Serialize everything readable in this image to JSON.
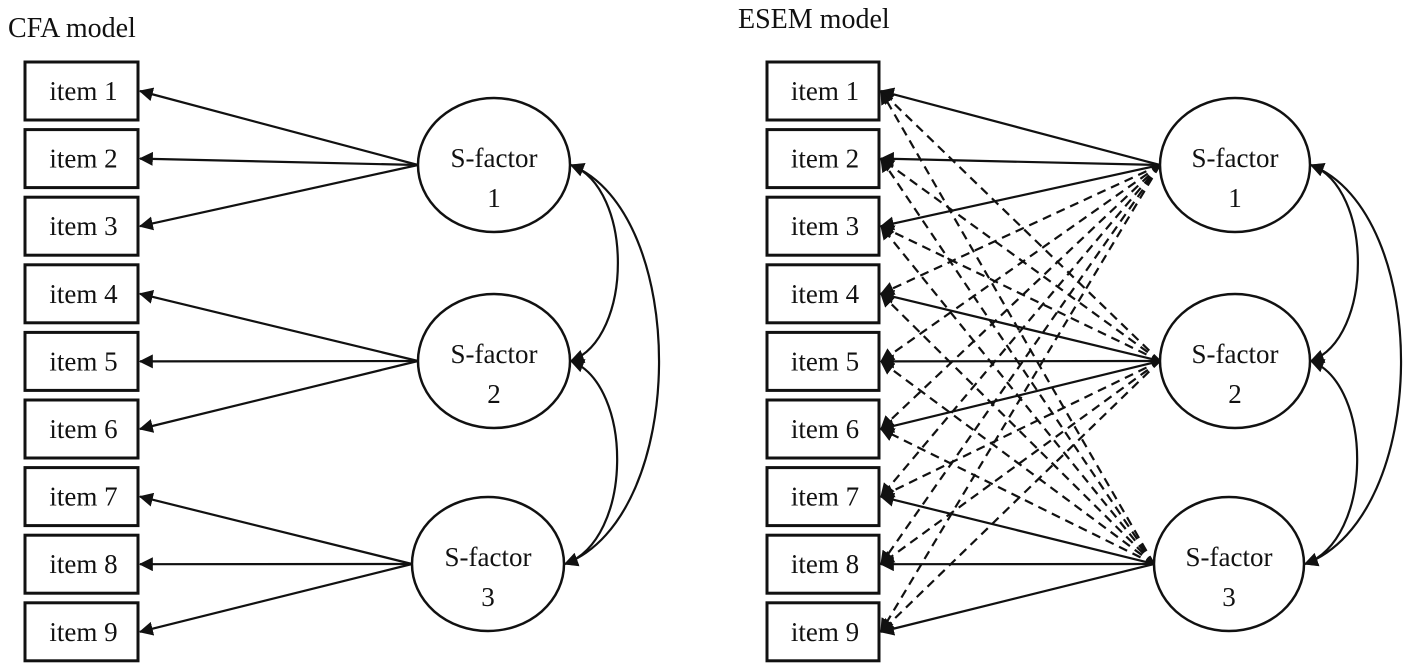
{
  "panels": [
    {
      "id": "cfa",
      "title": "CFA model",
      "items": [
        "item 1",
        "item 2",
        "item 3",
        "item 4",
        "item 5",
        "item 6",
        "item 7",
        "item 8",
        "item 9"
      ],
      "factors": [
        {
          "line1": "S-factor",
          "line2": "1"
        },
        {
          "line1": "S-factor",
          "line2": "2"
        },
        {
          "line1": "S-factor",
          "line2": "3"
        }
      ],
      "loadings": [
        {
          "factor": 1,
          "item": 1,
          "style": "solid"
        },
        {
          "factor": 1,
          "item": 2,
          "style": "solid"
        },
        {
          "factor": 1,
          "item": 3,
          "style": "solid"
        },
        {
          "factor": 2,
          "item": 4,
          "style": "solid"
        },
        {
          "factor": 2,
          "item": 5,
          "style": "solid"
        },
        {
          "factor": 2,
          "item": 6,
          "style": "solid"
        },
        {
          "factor": 3,
          "item": 7,
          "style": "solid"
        },
        {
          "factor": 3,
          "item": 8,
          "style": "solid"
        },
        {
          "factor": 3,
          "item": 9,
          "style": "solid"
        }
      ],
      "covariances": [
        {
          "from": 1,
          "to": 2
        },
        {
          "from": 2,
          "to": 3
        },
        {
          "from": 1,
          "to": 3
        }
      ]
    },
    {
      "id": "esem",
      "title": "ESEM model",
      "items": [
        "item 1",
        "item 2",
        "item 3",
        "item 4",
        "item 5",
        "item 6",
        "item 7",
        "item 8",
        "item 9"
      ],
      "factors": [
        {
          "line1": "S-factor",
          "line2": "1"
        },
        {
          "line1": "S-factor",
          "line2": "2"
        },
        {
          "line1": "S-factor",
          "line2": "3"
        }
      ],
      "loading_rule": "solid for target items of each factor, dashed cross-loadings to all other items",
      "targets": {
        "1": [
          1,
          2,
          3
        ],
        "2": [
          4,
          5,
          6
        ],
        "3": [
          7,
          8,
          9
        ]
      },
      "covariances": [
        {
          "from": 1,
          "to": 2
        },
        {
          "from": 2,
          "to": 3
        },
        {
          "from": 1,
          "to": 3
        }
      ]
    }
  ]
}
